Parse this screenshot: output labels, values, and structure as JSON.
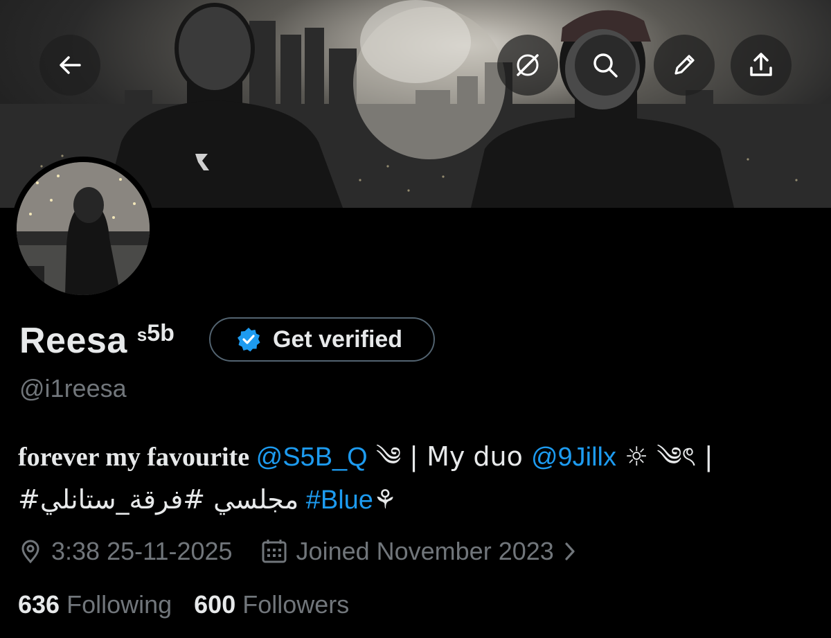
{
  "header": {
    "back_icon": "arrow-left-icon",
    "actions": [
      "grok-icon",
      "search-icon",
      "edit-pencil-icon",
      "share-icon"
    ]
  },
  "profile": {
    "display_name": "Reesa",
    "name_suffix_small": "s",
    "name_suffix_large": "5b",
    "verify_button_label": "Get verified",
    "handle": "@i1reesa",
    "bio": {
      "line1": {
        "text1": "forever my favourite ",
        "mention1": "@S5B_Q",
        "text2": " ༄ | My duo ",
        "mention2": "@9Jillx",
        "text3": " ☼ ༄ৎ |"
      },
      "line2": {
        "text1": "#مجلسي #فرقة_ستانلي",
        "hashtag": "#Blue",
        "text2": "⚘"
      }
    },
    "location_text": "3:38 25-11-2025",
    "joined_text": "Joined November 2023",
    "following_count": "636",
    "following_label": "Following",
    "followers_count": "600",
    "followers_label": "Followers"
  },
  "colors": {
    "background": "#000000",
    "link": "#1d9bf0",
    "secondary_text": "#71767b",
    "verified_badge": "#1d9bf0"
  }
}
